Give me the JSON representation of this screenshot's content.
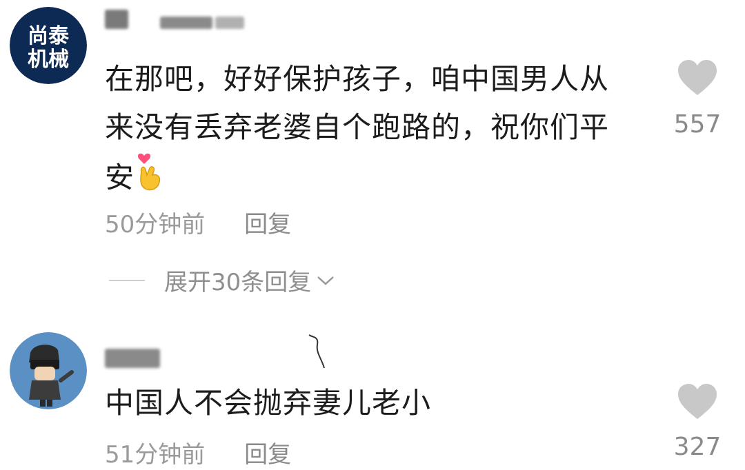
{
  "comments": [
    {
      "avatar_text_top": "尚泰",
      "avatar_text_bottom": "机械",
      "text_line1": "在那吧，好好保护孩子，咱中国男人从",
      "text_line2": "来没有丢弃老婆自个跑路的，祝你们平",
      "text_line3": "安",
      "emoji": "finger-heart-emoji",
      "time": "50分钟前",
      "reply_label": "回复",
      "likes": "557"
    },
    {
      "text_line1": "中国人不会抛弃妻儿老小",
      "time": "51分钟前",
      "reply_label": "回复",
      "likes": "327"
    }
  ],
  "expand_replies_label": "展开30条回复",
  "colors": {
    "avatar1_bg": "#0d2a55",
    "avatar2_bg": "#5a90c4",
    "meta_text": "#9a9a9a",
    "heart": "#c8c8c8"
  },
  "icons": [
    "heart-icon",
    "chevron-down-icon",
    "finger-heart-emoji"
  ]
}
